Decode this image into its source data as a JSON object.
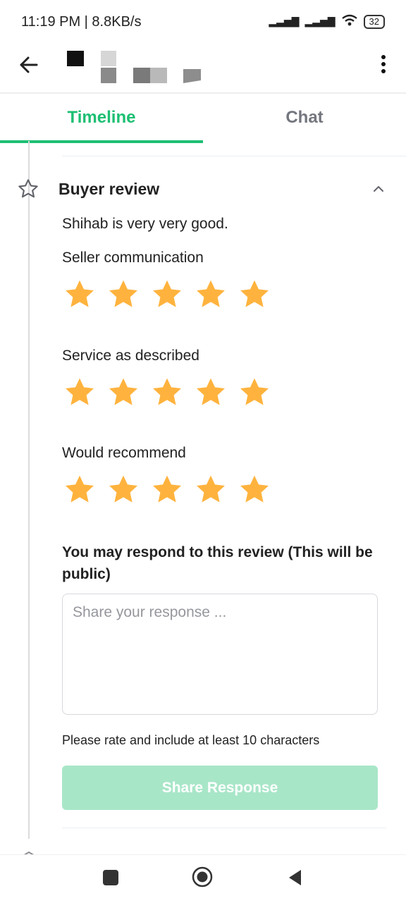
{
  "status_bar": {
    "time": "11:19 PM | 8.8KB/s",
    "battery": "32"
  },
  "tabs": [
    {
      "label": "Timeline",
      "active": true
    },
    {
      "label": "Chat",
      "active": false
    }
  ],
  "review": {
    "section_title": "Buyer review",
    "text": "Shihab is very very good.",
    "categories": [
      {
        "label": "Seller communication",
        "rating": 5,
        "max": 5
      },
      {
        "label": "Service as described",
        "rating": 5,
        "max": 5
      },
      {
        "label": "Would recommend",
        "rating": 5,
        "max": 5
      }
    ]
  },
  "respond": {
    "title": "You may respond to this review (This will be public)",
    "placeholder": "Share your response ...",
    "value": "",
    "hint": "Please rate and include at least 10 characters",
    "button_label": "Share Response"
  },
  "colors": {
    "accent": "#1dbf73",
    "star": "#ffb33e",
    "button_disabled": "#a8e6c8"
  },
  "icons": [
    "arrow-left-icon",
    "more-vertical-icon",
    "star-outline-icon",
    "chevron-up-icon",
    "star-icon",
    "nav-recent-icon",
    "nav-home-icon",
    "nav-back-icon"
  ]
}
